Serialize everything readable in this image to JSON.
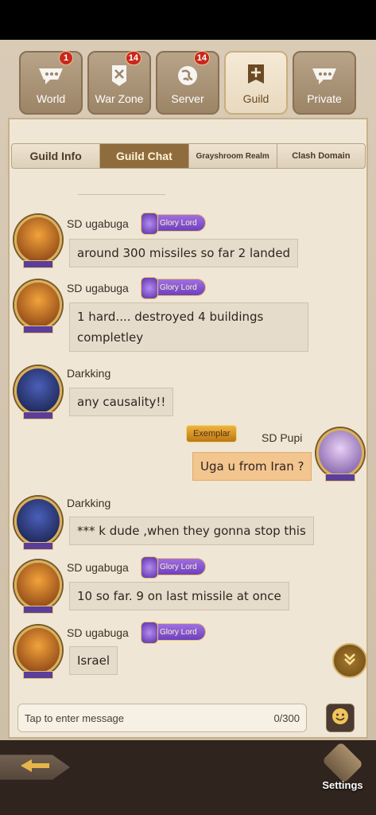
{
  "channel_tabs": [
    {
      "label": "World",
      "badge": "1",
      "icon": "chat-bubbles-icon"
    },
    {
      "label": "War Zone",
      "badge": "14",
      "icon": "crossed-swords-icon"
    },
    {
      "label": "Server",
      "badge": "14",
      "icon": "globe-icon"
    },
    {
      "label": "Guild",
      "badge": "",
      "icon": "guild-banner-icon",
      "active": true
    },
    {
      "label": "Private",
      "badge": "",
      "icon": "chat-bubbles-icon"
    }
  ],
  "sub_tabs": [
    {
      "label": "Guild Info"
    },
    {
      "label": "Guild Chat",
      "active": true
    },
    {
      "label": "Grayshroom Realm"
    },
    {
      "label": "Clash Domain"
    }
  ],
  "messages": [
    {
      "name": "SD ugabuga",
      "title": "Glory Lord",
      "lines": [
        "around 300 missiles so far 2 landed"
      ]
    },
    {
      "name": "SD ugabuga",
      "title": "Glory Lord",
      "lines": [
        "1 hard.... destroyed 4 buildings",
        "completley"
      ]
    },
    {
      "name": "Darkking",
      "title": "",
      "lines": [
        "any causality!!"
      ]
    },
    {
      "name": "SD Pupi",
      "title": "Exemplar",
      "lines": [
        "Uga u from Iran ?"
      ],
      "mine": true
    },
    {
      "name": "Darkking",
      "title": "",
      "lines": [
        "*** k dude ,when they gonna stop this"
      ]
    },
    {
      "name": "SD ugabuga",
      "title": "Glory Lord",
      "lines": [
        "10 so far. 9 on last missile at once"
      ]
    },
    {
      "name": "SD ugabuga",
      "title": "Glory Lord",
      "lines": [
        "Israel"
      ]
    }
  ],
  "input": {
    "placeholder": "Tap to enter message",
    "counter": "0/300"
  },
  "bottom": {
    "settings_label": "Settings"
  },
  "colors": {
    "active_subtab": "#8f6c3d",
    "own_bubble": "#f3c58f",
    "badge": "#c8281d"
  }
}
